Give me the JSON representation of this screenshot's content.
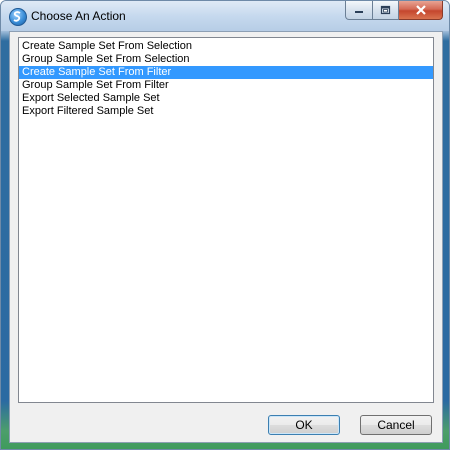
{
  "window": {
    "title": "Choose An Action",
    "icon": "app-icon"
  },
  "list": {
    "items": [
      {
        "label": "Create Sample Set From Selection",
        "selected": false
      },
      {
        "label": "Group Sample Set From Selection",
        "selected": false
      },
      {
        "label": "Create Sample Set From Filter",
        "selected": true
      },
      {
        "label": "Group Sample Set From Filter",
        "selected": false
      },
      {
        "label": "Export Selected Sample Set",
        "selected": false
      },
      {
        "label": "Export Filtered Sample Set",
        "selected": false
      }
    ]
  },
  "buttons": {
    "ok_label": "OK",
    "cancel_label": "Cancel"
  },
  "colors": {
    "selection": "#3399ff",
    "close_button": "#c5462e"
  }
}
